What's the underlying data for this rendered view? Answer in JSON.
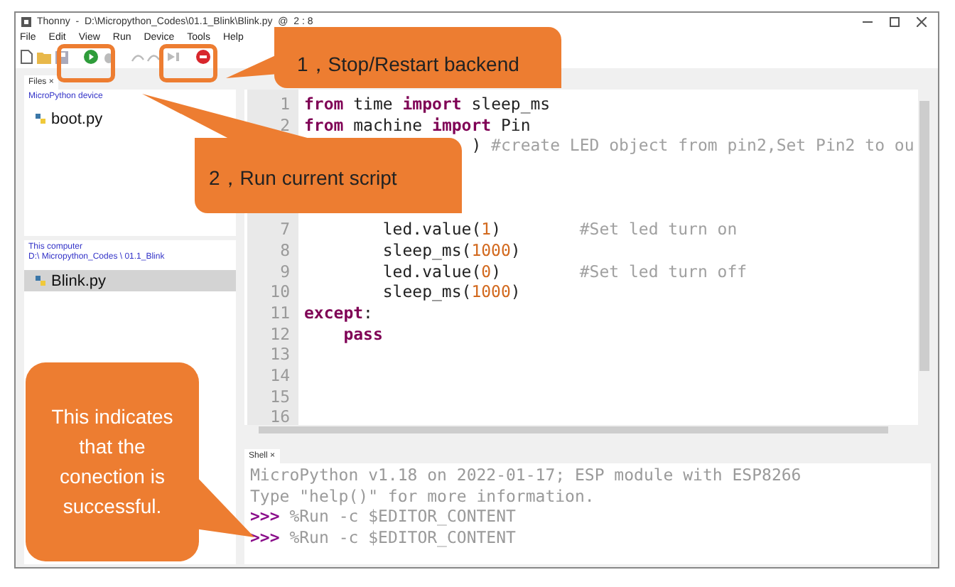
{
  "window": {
    "title": "Thonny  -  D:\\Micropython_Codes\\01.1_Blink\\Blink.py  @  2 : 8"
  },
  "menu": [
    "File",
    "Edit",
    "View",
    "Run",
    "Device",
    "Tools",
    "Help"
  ],
  "files_panel": {
    "tab": {
      "label": "Files",
      "close": "×"
    },
    "device": {
      "title": "MicroPython device",
      "files": [
        {
          "name": "boot.py",
          "selected": false
        }
      ]
    },
    "computer": {
      "title": "This computer",
      "path": "D:\\ Micropython_Codes \\ 01.1_Blink",
      "files": [
        {
          "name": "Blink.py",
          "selected": true
        }
      ]
    }
  },
  "editor": {
    "lines": [
      {
        "kind": "code",
        "number": "1",
        "segments": [
          {
            "kind": "keyword",
            "text": "from"
          },
          {
            "kind": "plain",
            "text": " time "
          },
          {
            "kind": "keyword",
            "text": "import"
          },
          {
            "kind": "plain",
            "text": " sleep_ms"
          }
        ]
      },
      {
        "kind": "code",
        "number": "2",
        "segments": [
          {
            "kind": "keyword",
            "text": "from"
          },
          {
            "kind": "plain",
            "text": " machine "
          },
          {
            "kind": "keyword",
            "text": "import"
          },
          {
            "kind": "plain",
            "text": " Pin"
          }
        ]
      },
      {
        "kind": "partial",
        "segments": [
          {
            "kind": "plain",
            "text": ")"
          },
          {
            "kind": "comment",
            "text": "#create LED object from pin2,Set Pin2 to ou"
          }
        ]
      },
      {
        "kind": "hidden"
      },
      {
        "kind": "hidden"
      },
      {
        "kind": "hidden"
      },
      {
        "kind": "code",
        "number": "7",
        "segments": [
          {
            "kind": "plain",
            "text": "        led.value("
          },
          {
            "kind": "number",
            "text": "1"
          },
          {
            "kind": "plain",
            "text": ")"
          },
          {
            "kind": "comment",
            "text": "#Set led turn on"
          }
        ]
      },
      {
        "kind": "code",
        "number": "8",
        "segments": [
          {
            "kind": "plain",
            "text": "        sleep_ms("
          },
          {
            "kind": "number",
            "text": "1000"
          },
          {
            "kind": "plain",
            "text": ")"
          }
        ]
      },
      {
        "kind": "code",
        "number": "9",
        "segments": [
          {
            "kind": "plain",
            "text": "        led.value("
          },
          {
            "kind": "number",
            "text": "0"
          },
          {
            "kind": "plain",
            "text": ")"
          },
          {
            "kind": "comment",
            "text": "#Set led turn off"
          }
        ]
      },
      {
        "kind": "code",
        "number": "10",
        "segments": [
          {
            "kind": "plain",
            "text": "        sleep_ms("
          },
          {
            "kind": "number",
            "text": "1000"
          },
          {
            "kind": "plain",
            "text": ")"
          }
        ]
      },
      {
        "kind": "code",
        "number": "11",
        "segments": [
          {
            "kind": "keyword",
            "text": "except"
          },
          {
            "kind": "plain",
            "text": ":"
          }
        ]
      },
      {
        "kind": "code",
        "number": "12",
        "segments": [
          {
            "kind": "keyword",
            "text": "    pass"
          }
        ]
      },
      {
        "kind": "code",
        "number": "13"
      },
      {
        "kind": "code",
        "number": "14"
      },
      {
        "kind": "code",
        "number": "15"
      },
      {
        "kind": "code",
        "number": "16"
      }
    ]
  },
  "shell": {
    "tab": {
      "label": "Shell",
      "close": "×"
    },
    "lines": [
      {
        "kind": "output",
        "text": "MicroPython v1.18 on 2022-01-17; ESP module with ESP8266"
      },
      {
        "kind": "output",
        "text": "Type \"help()\" for more information."
      },
      {
        "kind": "command",
        "prompt": ">>>",
        "text": "%Run -c $EDITOR_CONTENT"
      },
      {
        "kind": "command",
        "prompt": ">>>",
        "text": "%Run -c $EDITOR_CONTENT"
      }
    ]
  },
  "callouts": [
    {
      "kind": "stop",
      "text": "1，Stop/Restart backend"
    },
    {
      "kind": "run",
      "text": "2，Run current script"
    },
    {
      "kind": "shell",
      "text": "This indicates that the conection is successful."
    }
  ]
}
